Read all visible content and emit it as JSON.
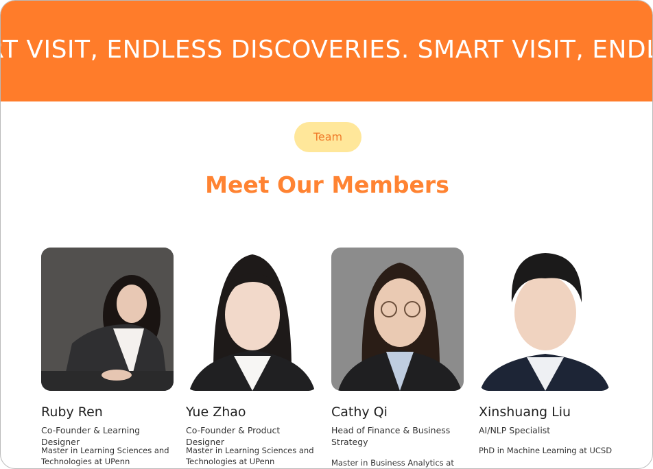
{
  "banner": {
    "text": "RT VISIT, ENDLESS DISCOVERIES. SMART VISIT, ENDLESS"
  },
  "section": {
    "badge": "Team",
    "title": "Meet Our Members"
  },
  "members": [
    {
      "name": "Ruby Ren",
      "role": "Co-Founder & Learning Designer",
      "education": "Master in Learning Sciences and Technologies at UPenn"
    },
    {
      "name": "Yue Zhao",
      "role": "Co-Founder & Product Designer",
      "education": "Master in Learning Sciences and Technologies at UPenn"
    },
    {
      "name": "Cathy Qi",
      "role": "Head of Finance & Business Strategy",
      "education": "Master in Business Analytics at"
    },
    {
      "name": "Xinshuang Liu",
      "role": "AI/NLP Specialist",
      "education": "PhD in Machine Learning at UCSD"
    }
  ],
  "colors": {
    "accent": "#FF7C2A",
    "badge_bg": "#FFE79A",
    "heading": "#FF8332"
  }
}
